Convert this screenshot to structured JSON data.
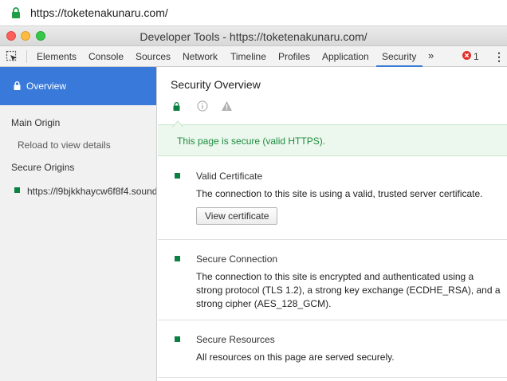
{
  "browser": {
    "url": "https://toketenakunaru.com/"
  },
  "window": {
    "title": "Developer Tools - https://toketenakunaru.com/"
  },
  "tabs": [
    {
      "label": "Elements",
      "active": false
    },
    {
      "label": "Console",
      "active": false
    },
    {
      "label": "Sources",
      "active": false
    },
    {
      "label": "Network",
      "active": false
    },
    {
      "label": "Timeline",
      "active": false
    },
    {
      "label": "Profiles",
      "active": false
    },
    {
      "label": "Application",
      "active": false
    },
    {
      "label": "Security",
      "active": true
    }
  ],
  "toolbar": {
    "more": "»",
    "error_count": "1",
    "menu": "⋮"
  },
  "sidebar": {
    "overview_label": "Overview",
    "main_origin_heading": "Main Origin",
    "main_origin_hint": "Reload to view details",
    "secure_origins_heading": "Secure Origins",
    "secure_origin": "https://l9bjkkhaycw6f8f4.sound"
  },
  "main": {
    "title": "Security Overview",
    "banner": "This page is secure (valid HTTPS).",
    "sections": [
      {
        "heading": "Valid Certificate",
        "description": "The connection to this site is using a valid, trusted server certificate.",
        "button": "View certificate"
      },
      {
        "heading": "Secure Connection",
        "description": "The connection to this site is encrypted and authenticated using a strong protocol (TLS 1.2), a strong key exchange (ECDHE_RSA), and a strong cipher (AES_128_GCM)."
      },
      {
        "heading": "Secure Resources",
        "description": "All resources on this page are served securely."
      }
    ]
  },
  "colors": {
    "secure_green": "#0b8043",
    "accent_blue": "#3879d9",
    "banner_text": "#1e8e3e"
  },
  "icons": [
    "lock-icon",
    "inspect-element-icon",
    "error-icon",
    "info-icon",
    "warning-icon"
  ]
}
